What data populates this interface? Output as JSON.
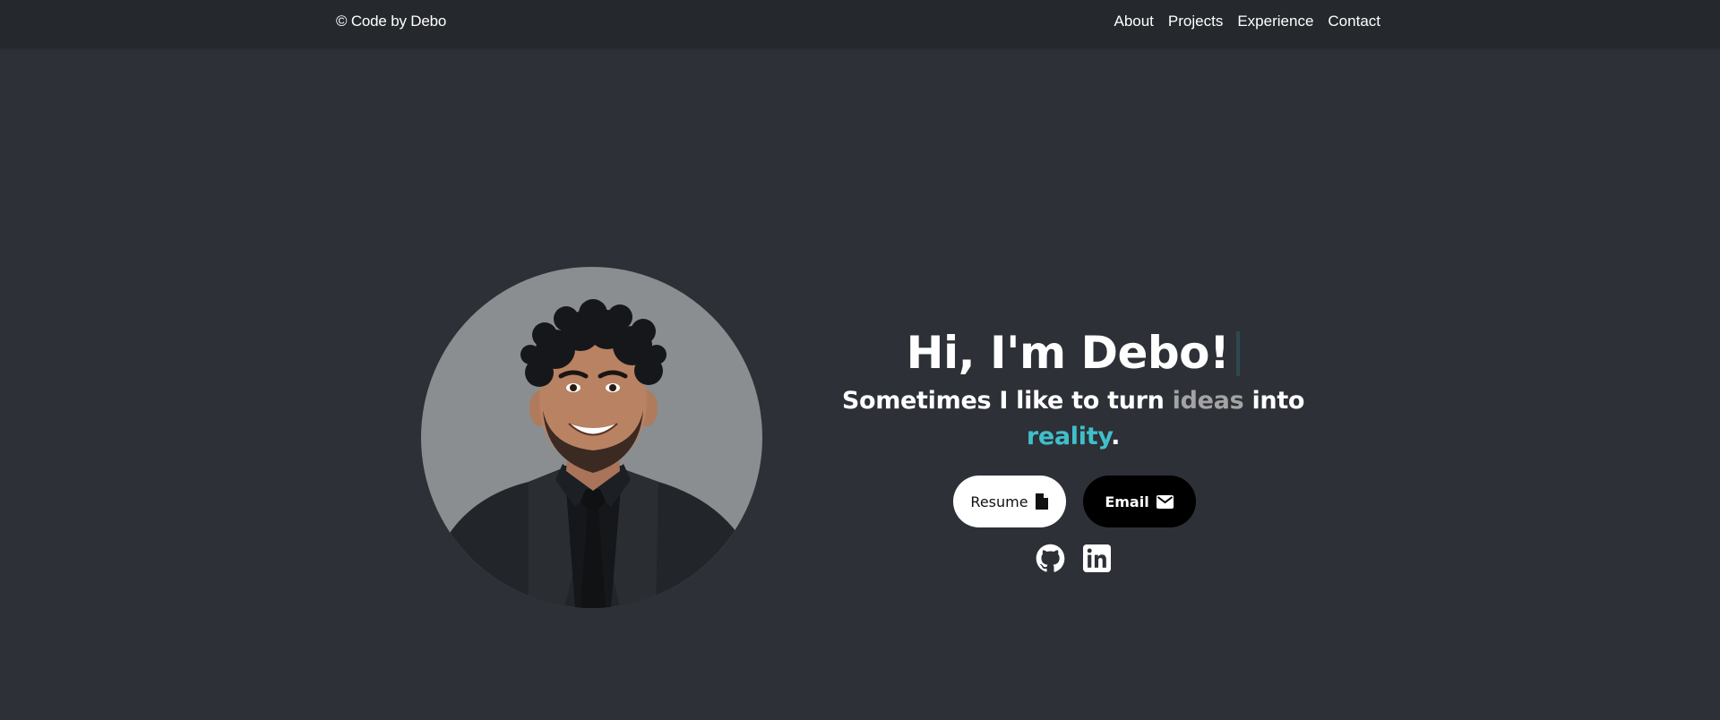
{
  "header": {
    "brand": "© Code by Debo",
    "nav": [
      {
        "label": "About"
      },
      {
        "label": "Projects"
      },
      {
        "label": "Experience"
      },
      {
        "label": "Contact"
      }
    ]
  },
  "hero": {
    "title": "Hi, I'm Debo!",
    "subtitle_prefix": "Sometimes I like to turn ",
    "subtitle_ideas": "ideas",
    "subtitle_mid": " into ",
    "subtitle_reality": "reality",
    "subtitle_suffix": ".",
    "resume_label": "Resume",
    "email_label": "Email",
    "colors": {
      "background": "#2d3036",
      "topbar": "#25282c",
      "accent": "#40bfca",
      "muted": "#a3a3a3"
    },
    "icons": [
      "file-icon",
      "mail-icon",
      "github-icon",
      "linkedin-icon"
    ]
  }
}
